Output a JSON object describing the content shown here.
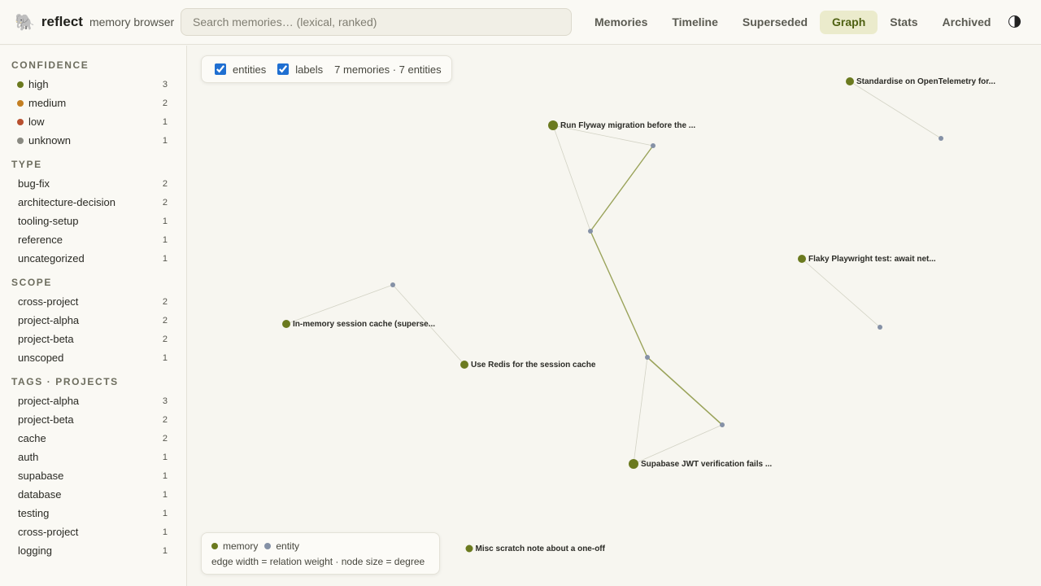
{
  "brand": {
    "name": "reflect",
    "subtitle": "memory browser",
    "icon": "elephant-icon",
    "glyph": "🐘"
  },
  "search": {
    "placeholder": "Search memories… (lexical, ranked)",
    "value": ""
  },
  "nav": {
    "tabs": [
      {
        "label": "Memories"
      },
      {
        "label": "Timeline"
      },
      {
        "label": "Superseded"
      },
      {
        "label": "Graph",
        "active": true
      },
      {
        "label": "Stats"
      },
      {
        "label": "Archived"
      }
    ],
    "theme_icon": "contrast-icon"
  },
  "sidebar": {
    "confidence": {
      "title": "CONFIDENCE",
      "items": [
        {
          "label": "high",
          "count": "3",
          "color": "#6b7a1f"
        },
        {
          "label": "medium",
          "count": "2",
          "color": "#c47f22"
        },
        {
          "label": "low",
          "count": "1",
          "color": "#b8502f"
        },
        {
          "label": "unknown",
          "count": "1",
          "color": "#8a8a82"
        }
      ]
    },
    "type": {
      "title": "TYPE",
      "items": [
        {
          "label": "bug-fix",
          "count": "2"
        },
        {
          "label": "architecture-decision",
          "count": "2"
        },
        {
          "label": "tooling-setup",
          "count": "1"
        },
        {
          "label": "reference",
          "count": "1"
        },
        {
          "label": "uncategorized",
          "count": "1"
        }
      ]
    },
    "scope": {
      "title": "SCOPE",
      "items": [
        {
          "label": "cross-project",
          "count": "2"
        },
        {
          "label": "project-alpha",
          "count": "2"
        },
        {
          "label": "project-beta",
          "count": "2"
        },
        {
          "label": "unscoped",
          "count": "1"
        }
      ]
    },
    "tags": {
      "title": "TAGS · PROJECTS",
      "items": [
        {
          "label": "project-alpha",
          "count": "3"
        },
        {
          "label": "project-beta",
          "count": "2"
        },
        {
          "label": "cache",
          "count": "2"
        },
        {
          "label": "auth",
          "count": "1"
        },
        {
          "label": "supabase",
          "count": "1"
        },
        {
          "label": "database",
          "count": "1"
        },
        {
          "label": "testing",
          "count": "1"
        },
        {
          "label": "cross-project",
          "count": "1"
        },
        {
          "label": "logging",
          "count": "1"
        }
      ]
    }
  },
  "graph": {
    "controls": {
      "entities_label": "entities",
      "entities_checked": true,
      "labels_label": "labels",
      "labels_checked": true,
      "summary": "7 memories · 7 entities"
    },
    "legend": {
      "memory_label": "memory",
      "entity_label": "entity",
      "note": "edge width = relation weight · node size = degree",
      "memory_color": "#6b7a1f",
      "entity_color": "#8591a6"
    },
    "memories": [
      {
        "id": "m-otel",
        "label": "Standardise on OpenTelemetry for..."
      },
      {
        "id": "m-flyway",
        "label": "Run Flyway migration before the ..."
      },
      {
        "id": "m-playwright",
        "label": "Flaky Playwright test: await net..."
      },
      {
        "id": "m-inmem",
        "label": "In-memory session cache (superse..."
      },
      {
        "id": "m-redis",
        "label": "Use Redis for the session cache"
      },
      {
        "id": "m-jwt",
        "label": "Supabase JWT verification fails ..."
      },
      {
        "id": "m-misc",
        "label": "Misc scratch note about a one-off"
      }
    ]
  }
}
